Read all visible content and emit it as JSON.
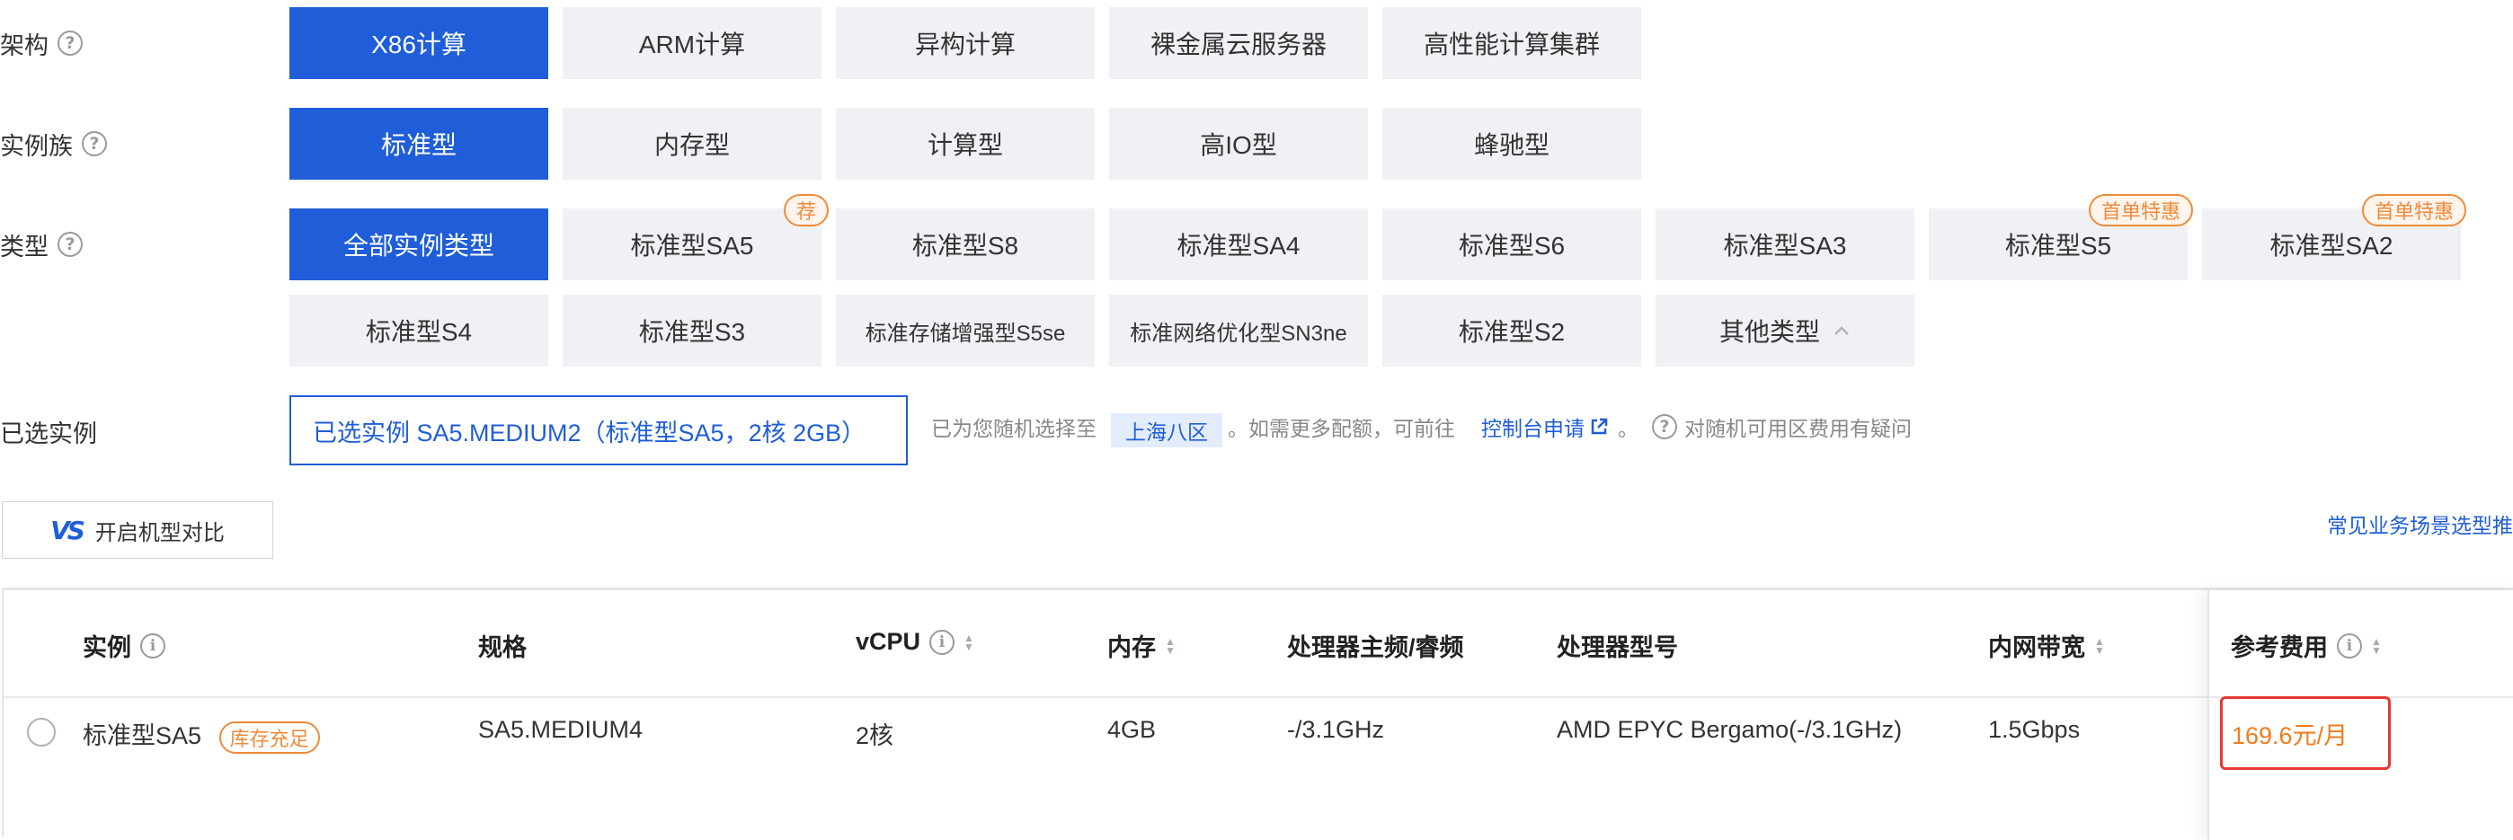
{
  "architecture": {
    "label": "架构",
    "options": [
      "X86计算",
      "ARM计算",
      "异构计算",
      "裸金属云服务器",
      "高性能计算集群"
    ]
  },
  "instance_family": {
    "label": "实例族",
    "options": [
      "标准型",
      "内存型",
      "计算型",
      "高IO型",
      "蜂驰型"
    ]
  },
  "type": {
    "label": "类型",
    "row1": [
      "全部实例类型",
      "标准型SA5",
      "标准型S8",
      "标准型SA4",
      "标准型S6",
      "标准型SA3",
      "标准型S5",
      "标准型SA2"
    ],
    "row2": [
      "标准型S4",
      "标准型S3",
      "标准存储增强型S5se",
      "标准网络优化型SN3ne",
      "标准型S2",
      "其他类型"
    ],
    "tags": {
      "recommend": "荐",
      "first_order_1": "首单特惠",
      "first_order_2": "首单特惠"
    }
  },
  "selected": {
    "label": "已选实例",
    "value": "已选实例 SA5.MEDIUM2（标准型SA5，2核 2GB）",
    "note_prefix": "已为您随机选择至",
    "zone": "上海八区",
    "note_middle": "。如需更多配额，可前往",
    "console_link": "控制台申请",
    "note_suffix": "。",
    "question": "对随机可用区费用有疑问"
  },
  "compare_button": "开启机型对比",
  "scene_link": "常见业务场景选型推",
  "table": {
    "headers": [
      "实例",
      "规格",
      "vCPU",
      "内存",
      "处理器主频/睿频",
      "处理器型号",
      "内网带宽",
      "参考费用"
    ],
    "row": {
      "instance": "标准型SA5",
      "stock": "库存充足",
      "spec": "SA5.MEDIUM4",
      "vcpu": "2核",
      "memory": "4GB",
      "freq": "-/3.1GHz",
      "cpu_model": "AMD EPYC Bergamo(-/3.1GHz)",
      "bandwidth": "1.5Gbps",
      "price": "169.6元/月"
    }
  },
  "colors": {
    "primary": "#1f5ed8",
    "tag_orange": "#f08a3a",
    "price": "#f07b1d",
    "highlight_border": "#e53935"
  }
}
